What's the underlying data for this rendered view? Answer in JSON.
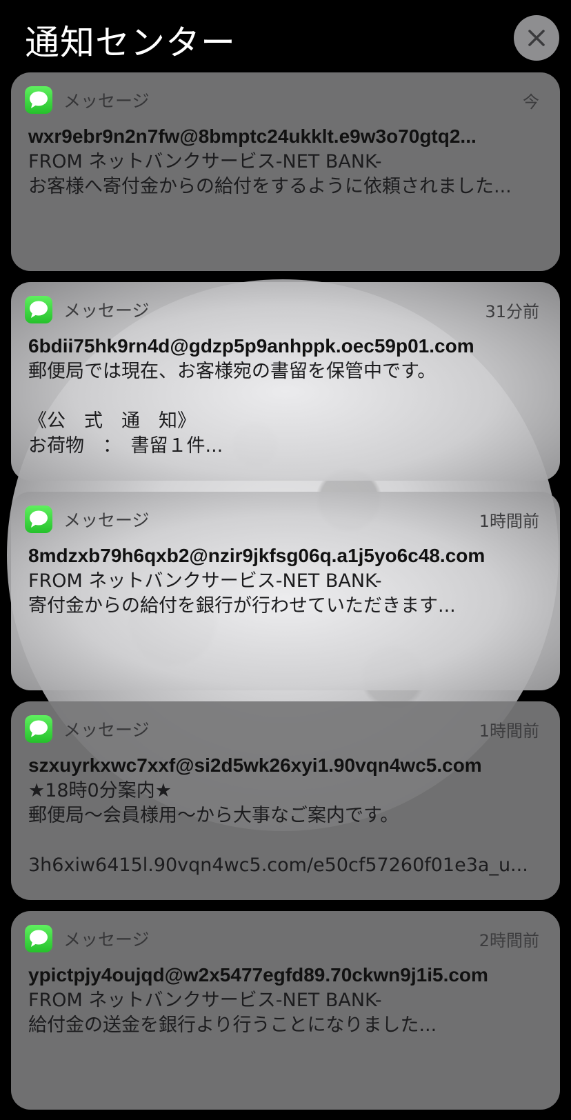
{
  "header": {
    "title": "通知センター",
    "close_icon": "close-icon"
  },
  "notifications": [
    {
      "app": "メッセージ",
      "time": "今",
      "sender": "wxr9ebr9n2n7fw@8bmptc24ukklt.e9w3o70gtq2...",
      "lines": [
        "FROM ネットバンクサービス-NET BANK-",
        "お客様へ寄付金からの給付をするように依頼されました..."
      ]
    },
    {
      "app": "メッセージ",
      "time": "31分前",
      "sender": "6bdii75hk9rn4d@gdzp5p9anhppk.oec59p01.com",
      "lines": [
        "郵便局では現在、お客様宛の書留を保管中です。",
        "",
        "《公　式　通　知》",
        "お荷物　：　書留１件..."
      ]
    },
    {
      "app": "メッセージ",
      "time": "1時間前",
      "sender": "8mdzxb79h6qxb2@nzir9jkfsg06q.a1j5yo6c48.com",
      "lines": [
        "FROM ネットバンクサービス-NET BANK-",
        "寄付金からの給付を銀行が行わせていただきます..."
      ]
    },
    {
      "app": "メッセージ",
      "time": "1時間前",
      "sender": "szxuyrkxwc7xxf@si2d5wk26xyi1.90vqn4wc5.com",
      "lines": [
        "★18時0分案内★",
        "郵便局〜会員様用〜から大事なご案内です。",
        "",
        "3h6xiw6415l.90vqn4wc5.com/e50cf57260f01e3a_u..."
      ]
    },
    {
      "app": "メッセージ",
      "time": "2時間前",
      "sender": "ypictpjy4oujqd@w2x5477egfd89.70ckwn9j1i5.com",
      "lines": [
        "FROM ネットバンクサービス-NET BANK-",
        "給付金の送金を銀行より行うことになりました..."
      ]
    }
  ]
}
